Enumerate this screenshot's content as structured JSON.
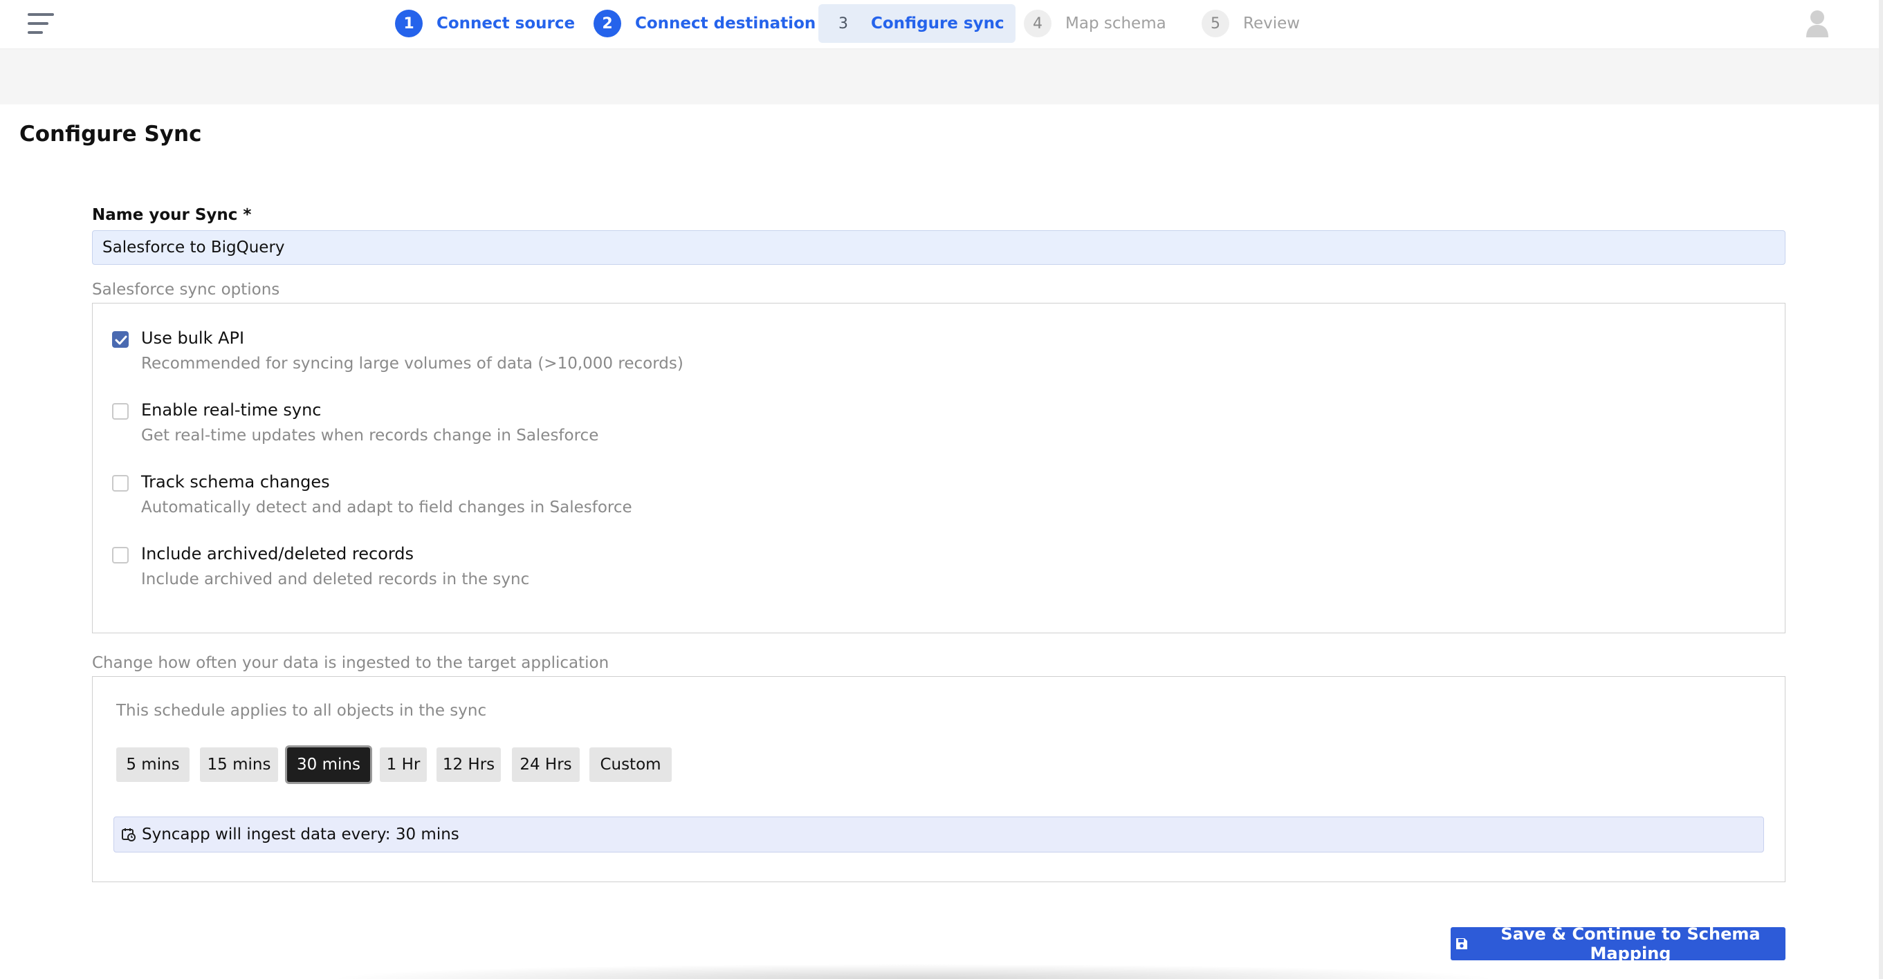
{
  "stepper": [
    {
      "num": "1",
      "label": "Connect source",
      "state": "done"
    },
    {
      "num": "2",
      "label": "Connect destination",
      "state": "done"
    },
    {
      "num": "3",
      "label": "Configure sync",
      "state": "active"
    },
    {
      "num": "4",
      "label": "Map schema",
      "state": "todo"
    },
    {
      "num": "5",
      "label": "Review",
      "state": "todo"
    }
  ],
  "page": {
    "title": "Configure Sync"
  },
  "sync_name": {
    "label": "Name your Sync *",
    "value": "Salesforce to BigQuery"
  },
  "options": {
    "section_label": "Salesforce sync options",
    "items": [
      {
        "title": "Use bulk API",
        "desc": "Recommended for syncing large volumes of data (>10,000 records)",
        "checked": true
      },
      {
        "title": "Enable real-time sync",
        "desc": "Get real-time updates when records change in Salesforce",
        "checked": false
      },
      {
        "title": "Track schema changes",
        "desc": "Automatically detect and adapt to field changes in Salesforce",
        "checked": false
      },
      {
        "title": "Include archived/deleted records",
        "desc": "Include archived and deleted records in the sync",
        "checked": false
      }
    ]
  },
  "schedule": {
    "section_label": "Change how often your data is ingested to the target application",
    "note": "This schedule applies to all objects in the sync",
    "options": [
      "5 mins",
      "15 mins",
      "30 mins",
      "1 Hr",
      "12 Hrs",
      "24 Hrs",
      "Custom"
    ],
    "selected": "30 mins",
    "summary": "Syncapp will ingest data every: 30 mins"
  },
  "actions": {
    "save_label": "Save & Continue to Schema Mapping"
  },
  "colors": {
    "accent": "#2563eb",
    "button": "#2d5bd8",
    "checkbox": "#4a6ab1",
    "selected_schedule": "#1e1e1e"
  }
}
